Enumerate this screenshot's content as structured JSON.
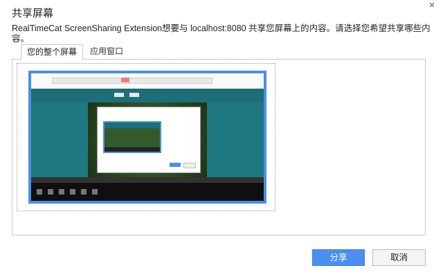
{
  "dialog": {
    "title": "共享屏幕",
    "close_label": "×",
    "description": "RealTimeCat ScreenSharing Extension想要与 localhost:8080 共享您屏幕上的内容。请选择您希望共享哪些内容。"
  },
  "tabs": [
    {
      "label": "您的整个屏幕",
      "active": true
    },
    {
      "label": "应用窗口",
      "active": false
    }
  ],
  "buttons": {
    "share_label": "分享",
    "cancel_label": "取消"
  },
  "colors": {
    "accent": "#4a8ff0",
    "thumb_border": "#4a8fe6",
    "app_teal": "#1d6e78"
  },
  "icons": {
    "close": "close-icon"
  }
}
